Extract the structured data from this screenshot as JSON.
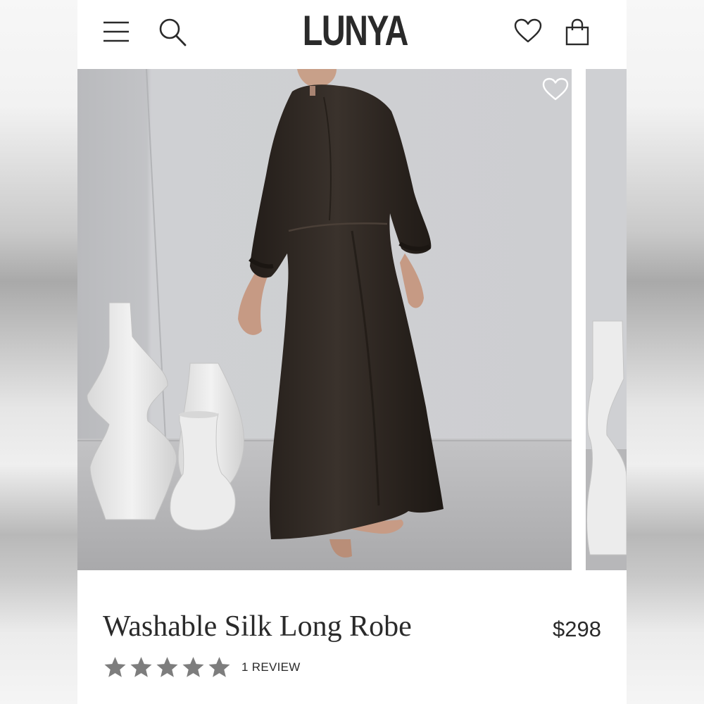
{
  "brand": {
    "logo_text": "LUNYA"
  },
  "header": {
    "icons": [
      "menu-icon",
      "search-icon",
      "heart-icon",
      "shopping-bag-icon"
    ]
  },
  "product": {
    "name": "Washable Silk Long Robe",
    "price": "$298",
    "rating": 5,
    "rating_max": 5,
    "review_label": "1 REVIEW",
    "image_index": 1
  },
  "colors": {
    "text": "#2a2a2a",
    "star": "#7d7d7d",
    "robe": "#2e2722",
    "wall": "#c9cacd",
    "floor": "#b9b9bb",
    "vase": "#e9e9e9"
  }
}
